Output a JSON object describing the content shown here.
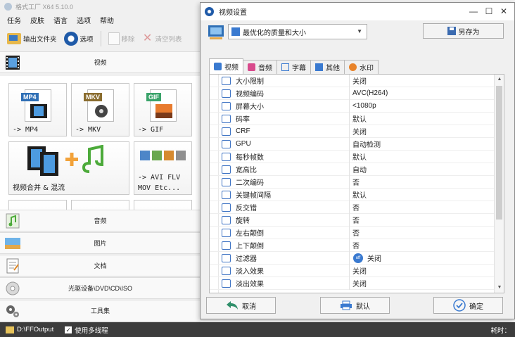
{
  "app": {
    "title": "格式工厂 X64 5.10.0",
    "menu": [
      "任务",
      "皮肤",
      "语言",
      "选项",
      "帮助"
    ],
    "toolbar": {
      "output_folder": "输出文件夹",
      "options": "选项",
      "remove": "移除",
      "clear_list": "清空列表"
    },
    "categories": {
      "video": "视频",
      "audio": "音频",
      "image": "图片",
      "document": "文档",
      "disc": "光驱设备\\DVD\\CD\\ISO",
      "tools": "工具集"
    },
    "tiles": {
      "mp4_badge": "MP4",
      "mp4": "-> MP4",
      "mkv_badge": "MKV",
      "mkv": "-> MKV",
      "gif_badge": "GIF",
      "gif": "-> GIF",
      "merge": "视频合并 & 混流",
      "avi_line1": "-> AVI FLV",
      "avi_line2": "MOV Etc..."
    },
    "status": {
      "path": "D:\\FFOutput",
      "multithread": "使用多线程",
      "elapsed": "耗时："
    }
  },
  "dialog": {
    "title": "视频设置",
    "preset": "最优化的质量和大小",
    "save_as": "另存为",
    "tabs": [
      "视频",
      "音频",
      "字幕",
      "其他",
      "水印"
    ],
    "rows": [
      {
        "name": "大小限制",
        "value": "关闭",
        "icon": "size-limit-icon"
      },
      {
        "name": "视频编码",
        "value": "AVC(H264)",
        "icon": "codec-icon"
      },
      {
        "name": "屏幕大小",
        "value": "<1080p",
        "icon": "monitor-icon"
      },
      {
        "name": "码率",
        "value": "默认",
        "icon": "bitrate-icon"
      },
      {
        "name": "CRF",
        "value": "关闭",
        "icon": "crf-icon"
      },
      {
        "name": "GPU",
        "value": "自动检测",
        "icon": "gpu-icon"
      },
      {
        "name": "每秒帧数",
        "value": "默认",
        "icon": "fps-icon"
      },
      {
        "name": "宽高比",
        "value": "自动",
        "icon": "aspect-ratio-icon"
      },
      {
        "name": "二次编码",
        "value": "否",
        "icon": "two-pass-icon"
      },
      {
        "name": "关键帧间隔",
        "value": "默认",
        "icon": "keyframe-icon"
      },
      {
        "name": "反交错",
        "value": "否",
        "icon": "deinterlace-icon"
      },
      {
        "name": "旋转",
        "value": "否",
        "icon": "rotate-icon"
      },
      {
        "name": "左右颠倒",
        "value": "否",
        "icon": "flip-horizontal-icon"
      },
      {
        "name": "上下颠倒",
        "value": "否",
        "icon": "flip-vertical-icon"
      },
      {
        "name": "过滤器",
        "value": "关闭",
        "icon": "filter-icon",
        "value_icon": "off"
      },
      {
        "name": "淡入效果",
        "value": "关闭",
        "icon": "fade-in-icon"
      },
      {
        "name": "淡出效果",
        "value": "关闭",
        "icon": "fade-out-icon"
      }
    ],
    "buttons": {
      "cancel": "取消",
      "default": "默认",
      "ok": "确定"
    }
  }
}
